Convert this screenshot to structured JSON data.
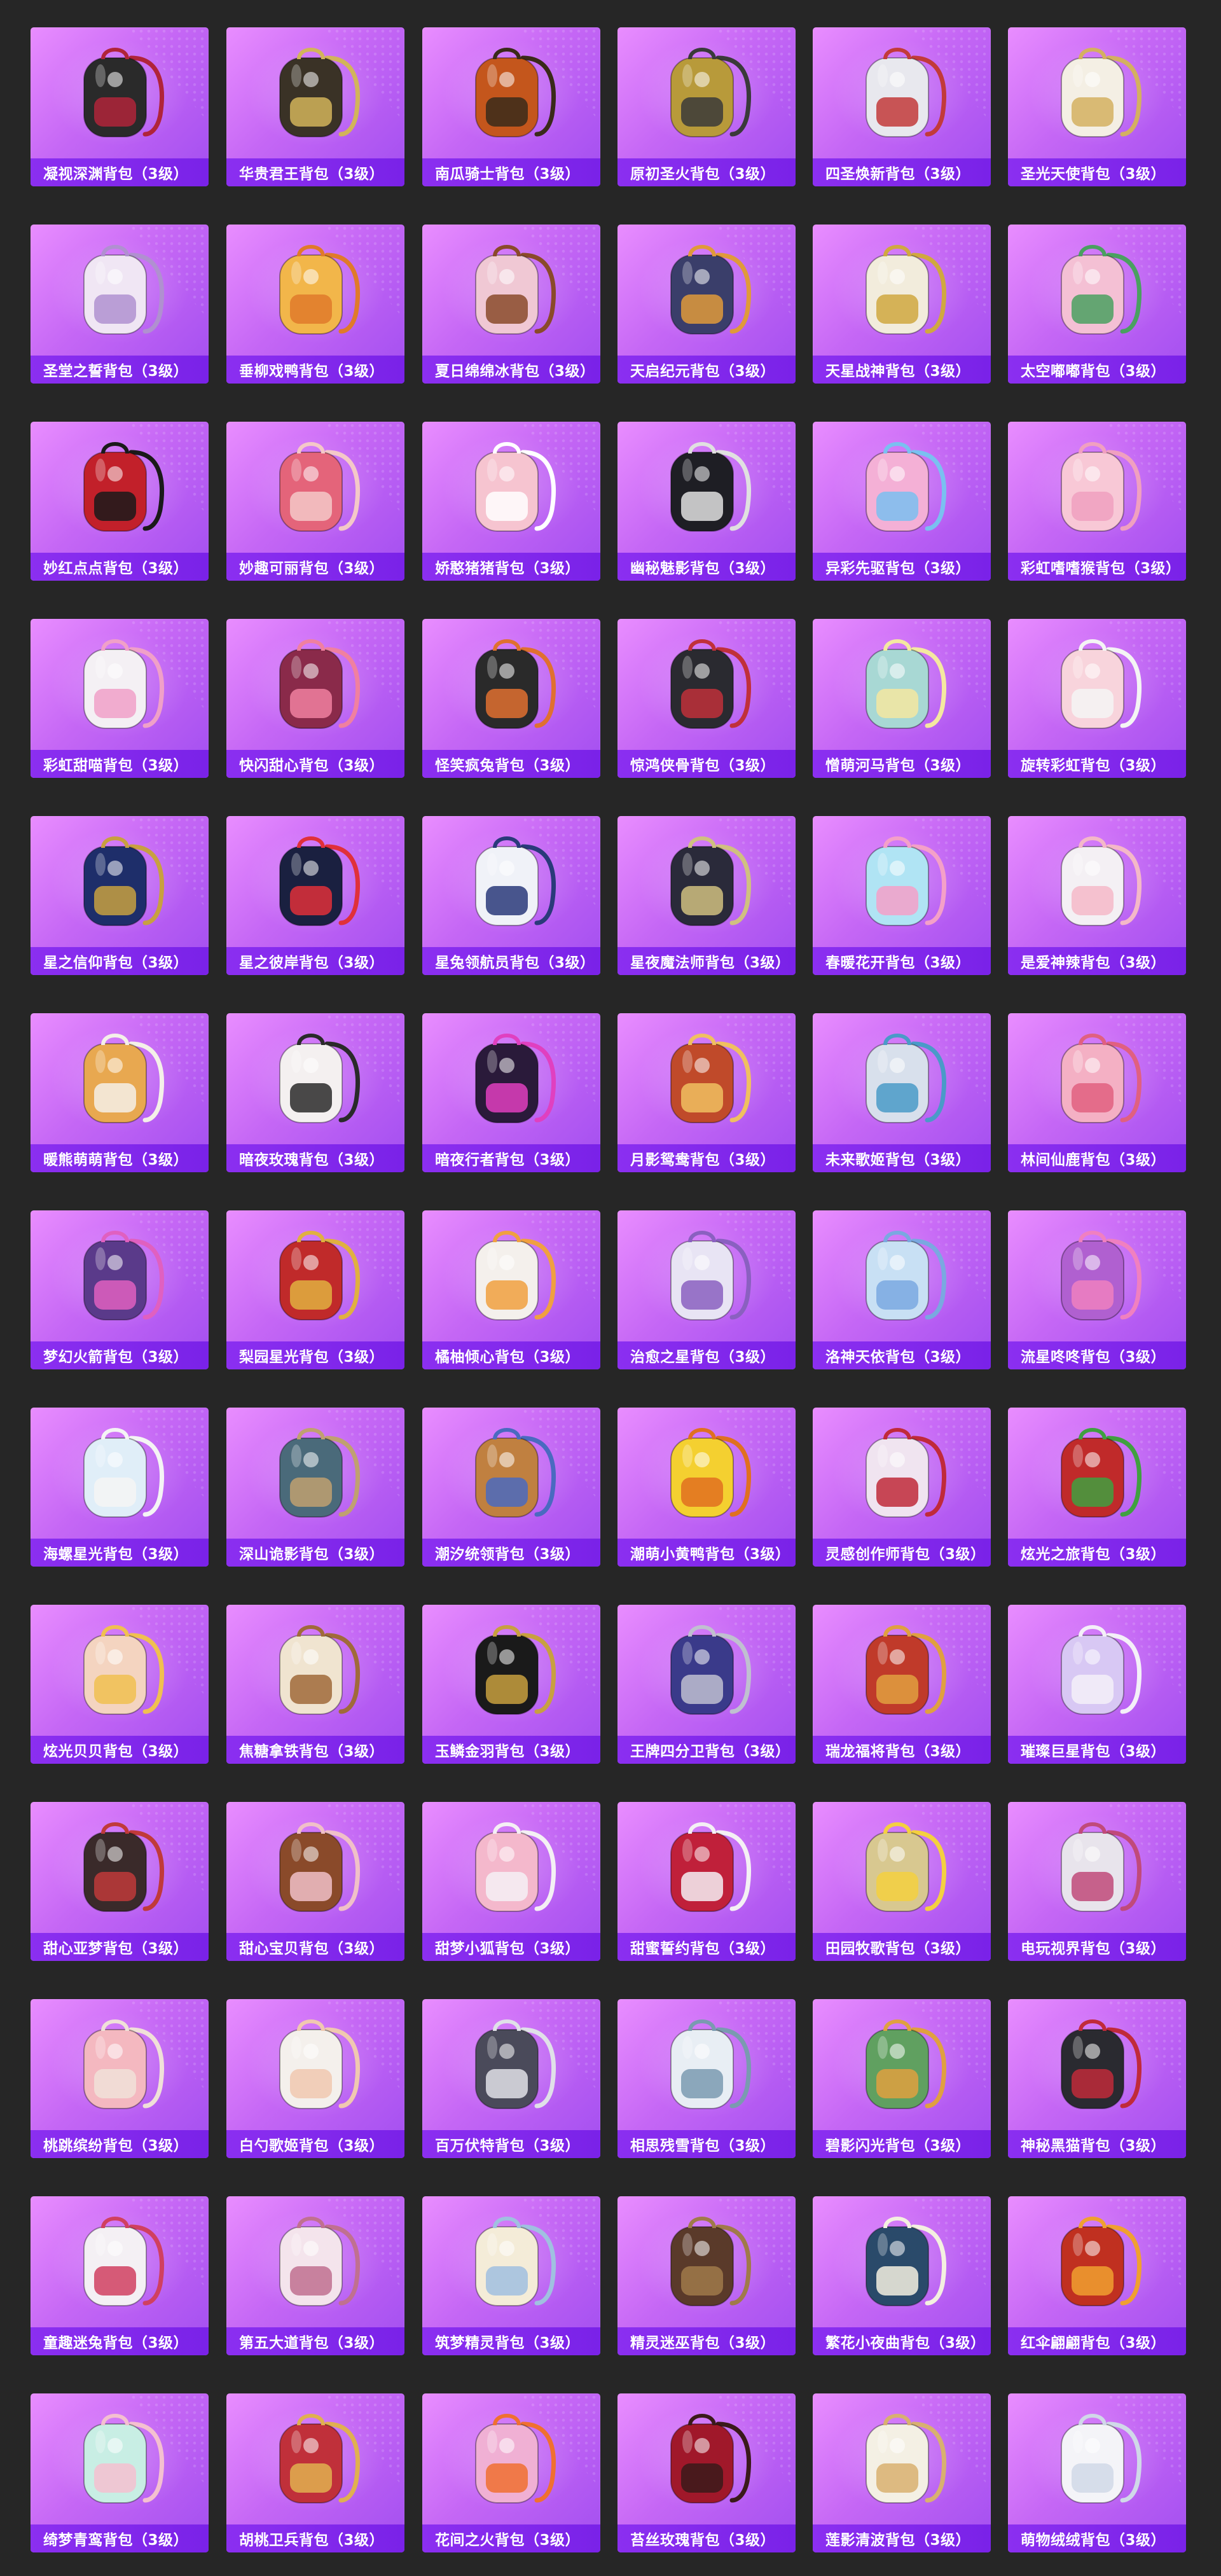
{
  "page": {
    "background": "#262626",
    "card_gradient": [
      "#e98dff",
      "#a24ef0"
    ],
    "label_bar_color": "#7a22e8",
    "label_text_color": "#ffffff"
  },
  "items": [
    {
      "name": "凝视深渊背包（3级）",
      "icon": "backpack-icon",
      "color": "#2a2a2a",
      "accent": "#b0243a"
    },
    {
      "name": "华贵君王背包（3级）",
      "icon": "backpack-icon",
      "color": "#3a3226",
      "accent": "#d2b45a"
    },
    {
      "name": "南瓜骑士背包（3级）",
      "icon": "backpack-icon",
      "color": "#c4561c",
      "accent": "#3a2a1a"
    },
    {
      "name": "原初圣火背包（3级）",
      "icon": "backpack-icon",
      "color": "#b89a3a",
      "accent": "#3a3a3a"
    },
    {
      "name": "四圣焕新背包（3级）",
      "icon": "backpack-icon",
      "color": "#e8e8ee",
      "accent": "#c23a3a"
    },
    {
      "name": "圣光天使背包（3级）",
      "icon": "backpack-icon",
      "color": "#f4efe4",
      "accent": "#d4b060"
    },
    {
      "name": "圣堂之誓背包（3级）",
      "icon": "backpack-icon",
      "color": "#f0e6f4",
      "accent": "#b090d0"
    },
    {
      "name": "垂柳戏鸭背包（3级）",
      "icon": "backpack-icon",
      "color": "#f2b64a",
      "accent": "#e07a2a"
    },
    {
      "name": "夏日绵绵冰背包（3级）",
      "icon": "backpack-icon",
      "color": "#f0c8d4",
      "accent": "#8a4a2a"
    },
    {
      "name": "天启纪元背包（3级）",
      "icon": "backpack-icon",
      "color": "#3a3e6a",
      "accent": "#e09a3a"
    },
    {
      "name": "天星战神背包（3级）",
      "icon": "backpack-icon",
      "color": "#f2ecdc",
      "accent": "#d0a840"
    },
    {
      "name": "太空嘟嘟背包（3级）",
      "icon": "backpack-icon",
      "color": "#f4c0d4",
      "accent": "#4aa060"
    },
    {
      "name": "妙红点点背包（3级）",
      "icon": "backpack-icon",
      "color": "#c2202a",
      "accent": "#1a1a1a"
    },
    {
      "name": "妙趣可丽背包（3级）",
      "icon": "backpack-icon",
      "color": "#e4647a",
      "accent": "#f4c8c8"
    },
    {
      "name": "娇憨猪猪背包（3级）",
      "icon": "backpack-icon",
      "color": "#f6c4d0",
      "accent": "#ffffff"
    },
    {
      "name": "幽秘魅影背包（3级）",
      "icon": "backpack-icon",
      "color": "#1e1e24",
      "accent": "#e0e0e0"
    },
    {
      "name": "异彩先驱背包（3级）",
      "icon": "backpack-icon",
      "color": "#f4b0d6",
      "accent": "#7ac0f0"
    },
    {
      "name": "彩虹嗜嗜猴背包（3级）",
      "icon": "backpack-icon",
      "color": "#f8c8d6",
      "accent": "#f0a0c0"
    },
    {
      "name": "彩虹甜喵背包（3级）",
      "icon": "backpack-icon",
      "color": "#f4f0f4",
      "accent": "#f0a0c8"
    },
    {
      "name": "快闪甜心背包（3级）",
      "icon": "backpack-icon",
      "color": "#8a2a4a",
      "accent": "#f080a0"
    },
    {
      "name": "怪笑疯兔背包（3级）",
      "icon": "backpack-icon",
      "color": "#2a2a2a",
      "accent": "#e07030"
    },
    {
      "name": "惊鸿侠骨背包（3级）",
      "icon": "backpack-icon",
      "color": "#2a2a30",
      "accent": "#c0303a"
    },
    {
      "name": "憎萌河马背包（3级）",
      "icon": "backpack-icon",
      "color": "#a8d8d4",
      "accent": "#f4e8a0"
    },
    {
      "name": "旋转彩虹背包（3级）",
      "icon": "backpack-icon",
      "color": "#f8d4dc",
      "accent": "#f4f4f4"
    },
    {
      "name": "星之信仰背包（3级）",
      "icon": "backpack-icon",
      "color": "#1e2e6a",
      "accent": "#c8a040"
    },
    {
      "name": "星之彼岸背包（3级）",
      "icon": "backpack-icon",
      "color": "#1a2040",
      "accent": "#e0303a"
    },
    {
      "name": "星兔领航员背包（3级）",
      "icon": "backpack-icon",
      "color": "#f0f2f8",
      "accent": "#2a3a7a"
    },
    {
      "name": "星夜魔法师背包（3级）",
      "icon": "backpack-icon",
      "color": "#2a2a3a",
      "accent": "#d0c080"
    },
    {
      "name": "春暖花开背包（3级）",
      "icon": "backpack-icon",
      "color": "#b0e4f4",
      "accent": "#f4a0c8"
    },
    {
      "name": "是爱神辣背包（3级）",
      "icon": "backpack-icon",
      "color": "#f4f0f4",
      "accent": "#f4b8c8"
    },
    {
      "name": "暖熊萌萌背包（3级）",
      "icon": "backpack-icon",
      "color": "#e8a850",
      "accent": "#f4f0e8"
    },
    {
      "name": "暗夜玫瑰背包（3级）",
      "icon": "backpack-icon",
      "color": "#f4f0f0",
      "accent": "#2a2a2a"
    },
    {
      "name": "暗夜行者背包（3级）",
      "icon": "backpack-icon",
      "color": "#2a1a3a",
      "accent": "#e040c0"
    },
    {
      "name": "月影鸳鸯背包（3级）",
      "icon": "backpack-icon",
      "color": "#c04a2a",
      "accent": "#f0c060"
    },
    {
      "name": "未来歌姬背包（3级）",
      "icon": "backpack-icon",
      "color": "#d8e0ec",
      "accent": "#4a9ac8"
    },
    {
      "name": "林间仙鹿背包（3级）",
      "icon": "backpack-icon",
      "color": "#f4b0c4",
      "accent": "#e06080"
    },
    {
      "name": "梦幻火箭背包（3级）",
      "icon": "backpack-icon",
      "color": "#5a3a8a",
      "accent": "#e060c0"
    },
    {
      "name": "梨园星光背包（3级）",
      "icon": "backpack-icon",
      "color": "#c02a2a",
      "accent": "#e0b040"
    },
    {
      "name": "橘柚倾心背包（3级）",
      "icon": "backpack-icon",
      "color": "#f4f0ec",
      "accent": "#f0a040"
    },
    {
      "name": "治愈之星背包（3级）",
      "icon": "backpack-icon",
      "color": "#e8e4f4",
      "accent": "#8a60c0"
    },
    {
      "name": "洛神天依背包（3级）",
      "icon": "backpack-icon",
      "color": "#c8e0f4",
      "accent": "#7aa8e0"
    },
    {
      "name": "流星咚咚背包（3级）",
      "icon": "backpack-icon",
      "color": "#b060d0",
      "accent": "#f080c0"
    },
    {
      "name": "海螺星光背包（3级）",
      "icon": "backpack-icon",
      "color": "#e0eef8",
      "accent": "#f4f4f4"
    },
    {
      "name": "深山诡影背包（3级）",
      "icon": "backpack-icon",
      "color": "#4a6a7a",
      "accent": "#c0a070"
    },
    {
      "name": "潮汐统领背包（3级）",
      "icon": "backpack-icon",
      "color": "#c08040",
      "accent": "#4a6ac0"
    },
    {
      "name": "潮萌小黄鸭背包（3级）",
      "icon": "backpack-icon",
      "color": "#f4d030",
      "accent": "#e07020"
    },
    {
      "name": "灵感创作师背包（3级）",
      "icon": "backpack-icon",
      "color": "#f0e4f0",
      "accent": "#c02a3a"
    },
    {
      "name": "炫光之旅背包（3级）",
      "icon": "backpack-icon",
      "color": "#c02a2a",
      "accent": "#40a040"
    },
    {
      "name": "炫光贝贝背包（3级）",
      "icon": "backpack-icon",
      "color": "#f4d4c0",
      "accent": "#f0c050"
    },
    {
      "name": "焦糖拿铁背包（3级）",
      "icon": "backpack-icon",
      "color": "#f0e4d0",
      "accent": "#a06a3a"
    },
    {
      "name": "玉鳞金羽背包（3级）",
      "icon": "backpack-icon",
      "color": "#1a1a1a",
      "accent": "#c8a040"
    },
    {
      "name": "王牌四分卫背包（3级）",
      "icon": "backpack-icon",
      "color": "#3a3a8a",
      "accent": "#c0c0d0"
    },
    {
      "name": "瑞龙福将背包（3级）",
      "icon": "backpack-icon",
      "color": "#c03a2a",
      "accent": "#e0a040"
    },
    {
      "name": "璀璨巨星背包（3级）",
      "icon": "backpack-icon",
      "color": "#d8c8f4",
      "accent": "#f4f0f8"
    },
    {
      "name": "甜心亚梦背包（3级）",
      "icon": "backpack-icon",
      "color": "#3a2a2a",
      "accent": "#c03a3a"
    },
    {
      "name": "甜心宝贝背包（3级）",
      "icon": "backpack-icon",
      "color": "#8a4a2a",
      "accent": "#f0c0c8"
    },
    {
      "name": "甜梦小狐背包（3级）",
      "icon": "backpack-icon",
      "color": "#f4b8cc",
      "accent": "#f4f0f4"
    },
    {
      "name": "甜蜜誓约背包（3级）",
      "icon": "backpack-icon",
      "color": "#c0203a",
      "accent": "#f4f0f4"
    },
    {
      "name": "田园牧歌背包（3级）",
      "icon": "backpack-icon",
      "color": "#d8c890",
      "accent": "#f4d040"
    },
    {
      "name": "电玩视界背包（3级）",
      "icon": "backpack-icon",
      "color": "#e8e4ec",
      "accent": "#c04a7a"
    },
    {
      "name": "桃跳缤纷背包（3级）",
      "icon": "backpack-icon",
      "color": "#f4b8c0",
      "accent": "#f0e0d8"
    },
    {
      "name": "白勺歌姬背包（3级）",
      "icon": "backpack-icon",
      "color": "#f4f0ec",
      "accent": "#f0c8b0"
    },
    {
      "name": "百万伏特背包（3级）",
      "icon": "backpack-icon",
      "color": "#4a4a5a",
      "accent": "#e0e0e8"
    },
    {
      "name": "相思残雪背包（3级）",
      "icon": "backpack-icon",
      "color": "#e8eef4",
      "accent": "#7a9ab0"
    },
    {
      "name": "碧影闪光背包（3级）",
      "icon": "backpack-icon",
      "color": "#60a060",
      "accent": "#e0a040"
    },
    {
      "name": "神秘黑猫背包（3级）",
      "icon": "backpack-icon",
      "color": "#2a2a30",
      "accent": "#c02a3a"
    },
    {
      "name": "童趣迷兔背包（3级）",
      "icon": "backpack-icon",
      "color": "#f4f0f4",
      "accent": "#d04060"
    },
    {
      "name": "第五大道背包（3级）",
      "icon": "backpack-icon",
      "color": "#f4e4ec",
      "accent": "#c07090"
    },
    {
      "name": "筑梦精灵背包（3级）",
      "icon": "backpack-icon",
      "color": "#f4ecd8",
      "accent": "#a0c0e0"
    },
    {
      "name": "精灵迷巫背包（3级）",
      "icon": "backpack-icon",
      "color": "#5a3a2a",
      "accent": "#a07a4a"
    },
    {
      "name": "繁花小夜曲背包（3级）",
      "icon": "backpack-icon",
      "color": "#2a4a6a",
      "accent": "#f4f0e0"
    },
    {
      "name": "红伞翩翩背包（3级）",
      "icon": "backpack-icon",
      "color": "#c03020",
      "accent": "#f0a030"
    },
    {
      "name": "绮梦青鸾背包（3级）",
      "icon": "backpack-icon",
      "color": "#c8eee4",
      "accent": "#f4c0d0"
    },
    {
      "name": "胡桃卫兵背包（3级）",
      "icon": "backpack-icon",
      "color": "#c0303a",
      "accent": "#e0b050"
    },
    {
      "name": "花间之火背包（3级）",
      "icon": "backpack-icon",
      "color": "#f0b0d4",
      "accent": "#f07030"
    },
    {
      "name": "苔丝玫瑰背包（3级）",
      "icon": "backpack-icon",
      "color": "#a0182a",
      "accent": "#3a1a1a"
    },
    {
      "name": "莲影清波背包（3级）",
      "icon": "backpack-icon",
      "color": "#f4f0e4",
      "accent": "#d8b070"
    },
    {
      "name": "萌物绒绒背包（3级）",
      "icon": "backpack-icon",
      "color": "#f4f4f8",
      "accent": "#d0d8e8"
    }
  ]
}
